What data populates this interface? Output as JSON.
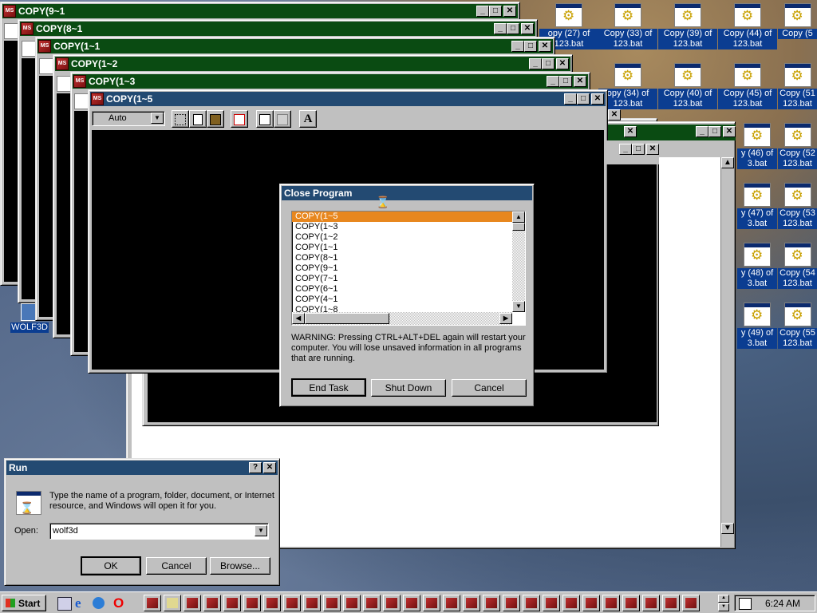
{
  "windows": {
    "w1": {
      "title": "COPY(9~1"
    },
    "w2": {
      "title": "COPY(8~1"
    },
    "w3": {
      "title": "COPY(1~1"
    },
    "w4": {
      "title": "COPY(1~2"
    },
    "w5": {
      "title": "COPY(1~3"
    },
    "w6": {
      "title": "COPY(1~5",
      "font_select": "Auto",
      "font_button": "A"
    }
  },
  "desktop_icons": {
    "wolf3d": "WOLF3D",
    "c27": "opy (27) of 123.bat",
    "c33": "Copy (33) of 123.bat",
    "c39": "Copy (39) of 123.bat",
    "c44": "Copy (44) of 123.bat",
    "c50": "Copy (5",
    "c34": "opy (34) of 123.bat",
    "c40": "Copy (40) of 123.bat",
    "c45": "Copy (45) of 123.bat",
    "c51": "Copy (51 123.bat",
    "c46": "y (46) of 3.bat",
    "c52": "Copy (52 123.bat",
    "c47": "y (47) of 3.bat",
    "c53": "Copy (53 123.bat",
    "c48": "y (48) of 3.bat",
    "c54": "Copy (54 123.bat",
    "c49": "y (49) of 3.bat",
    "c55": "Copy (55 123.bat"
  },
  "close_program": {
    "title": "Close Program",
    "items": [
      "COPY(1~5",
      "COPY(1~3",
      "COPY(1~2",
      "COPY(1~1",
      "COPY(8~1",
      "COPY(9~1",
      "COPY(7~1",
      "COPY(6~1",
      "COPY(4~1",
      "COPY(1~8"
    ],
    "warning": "WARNING: Pressing CTRL+ALT+DEL again will restart your computer. You will lose unsaved information in all programs that are running.",
    "end_task": "End Task",
    "shut_down": "Shut Down",
    "cancel": "Cancel"
  },
  "run": {
    "title": "Run",
    "help": "?",
    "description": "Type the name of a program, folder, document, or Internet resource, and Windows will open it for you.",
    "open_label": "Open:",
    "open_value": "wolf3d",
    "ok": "OK",
    "cancel": "Cancel",
    "browse": "Browse..."
  },
  "taskbar": {
    "start": "Start",
    "clock": "6:24 AM"
  },
  "colors": {
    "title_green": "#0a4b12",
    "title_blue": "#0b2a6e",
    "selection_orange": "#e8871e"
  }
}
